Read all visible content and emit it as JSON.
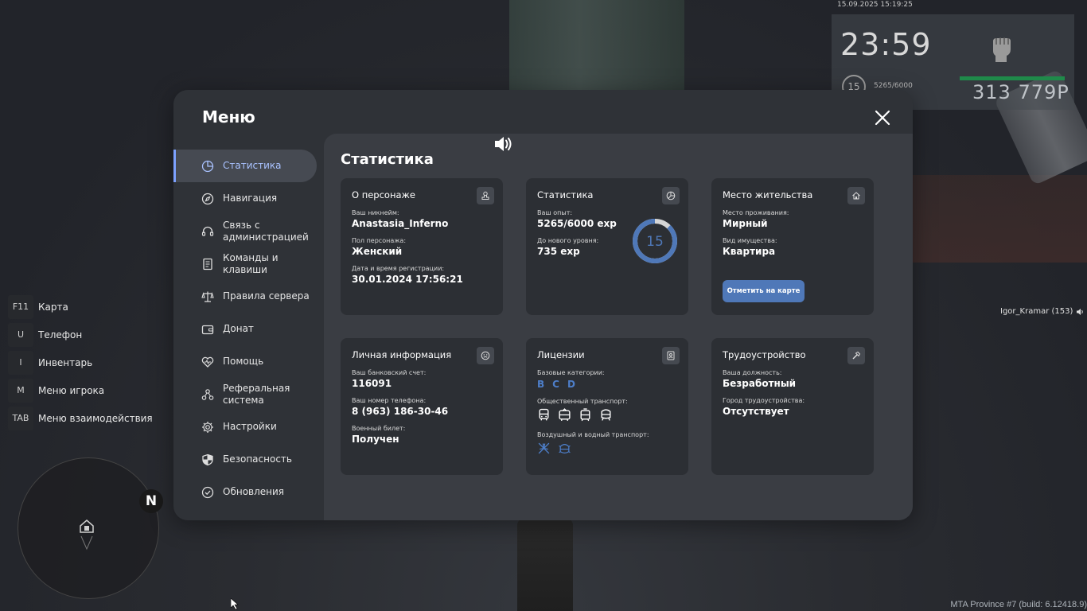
{
  "hud": {
    "datetime": "15.09.2025 15:19:25",
    "clock": "23:59",
    "level": "15",
    "exp": "5265/6000",
    "money": "313 779Р",
    "health_fraction": 1.0
  },
  "keybinds": [
    {
      "key": "F11",
      "label": "Карта"
    },
    {
      "key": "U",
      "label": "Телефон"
    },
    {
      "key": "I",
      "label": "Инвентарь"
    },
    {
      "key": "M",
      "label": "Меню игрока"
    },
    {
      "key": "TAB",
      "label": "Меню взаимодействия"
    }
  ],
  "radar": {
    "north": "N"
  },
  "player_tag": "Igor_Kramar (153)",
  "build": "MTA Province #7 (build: 6.12418.9)",
  "menu": {
    "title": "Меню",
    "nav": [
      {
        "label": "Статистика",
        "icon": "pie-chart-icon",
        "active": true
      },
      {
        "label": "Навигация",
        "icon": "compass-icon"
      },
      {
        "label": "Связь с администрацией",
        "icon": "headset-icon"
      },
      {
        "label": "Команды и клавиши",
        "icon": "document-icon"
      },
      {
        "label": "Правила сервера",
        "icon": "scales-icon"
      },
      {
        "label": "Донат",
        "icon": "wallet-icon"
      },
      {
        "label": "Помощь",
        "icon": "heart-icon"
      },
      {
        "label": "Реферальная система",
        "icon": "network-icon"
      },
      {
        "label": "Настройки",
        "icon": "gear-icon"
      },
      {
        "label": "Безопасность",
        "icon": "shield-icon"
      },
      {
        "label": "Обновления",
        "icon": "check-circle-icon"
      }
    ]
  },
  "stats": {
    "title": "Статистика",
    "character": {
      "title": "О персонаже",
      "nick_label": "Ваш никнейм:",
      "nick": "Anastasia_Inferno",
      "gender_label": "Пол персонажа:",
      "gender": "Женский",
      "reg_label": "Дата и время регистрации:",
      "reg": "30.01.2024 17:56:21"
    },
    "statistics": {
      "title": "Статистика",
      "exp_label": "Ваш опыт:",
      "exp": "5265/6000 exp",
      "next_label": "До нового уровня:",
      "next": "735 exp",
      "level": "15",
      "exp_current": 5265,
      "exp_max": 6000
    },
    "residence": {
      "title": "Место жительства",
      "place_label": "Место проживания:",
      "place": "Мирный",
      "property_label": "Вид имущества:",
      "property": "Квартира",
      "button": "Отметить на карте"
    },
    "personal": {
      "title": "Личная информация",
      "bank_label": "Ваш банковский счет:",
      "bank": "116091",
      "phone_label": "Ваш номер телефона:",
      "phone": "8 (963) 186-30-46",
      "military_label": "Военный билет:",
      "military": "Получен"
    },
    "licenses": {
      "title": "Лицензии",
      "base_label": "Базовые категории:",
      "base": [
        "B",
        "C",
        "D"
      ],
      "public_label": "Общественный транспорт:",
      "public_icons": [
        "bus-icon",
        "trolleybus-icon",
        "tram-icon",
        "metro-icon"
      ],
      "air_label": "Воздушный и водный транспорт:",
      "air_icons": [
        "plane-icon",
        "boat-icon"
      ]
    },
    "employment": {
      "title": "Трудоустройство",
      "position_label": "Ваша должность:",
      "position": "Безработный",
      "city_label": "Город трудоустройства:",
      "city": "Отсутствует"
    }
  },
  "colors": {
    "accent": "#7da1ff",
    "button": "#4f78b8",
    "license": "#4d7ec9",
    "money_bar": "#1f8a4a"
  }
}
